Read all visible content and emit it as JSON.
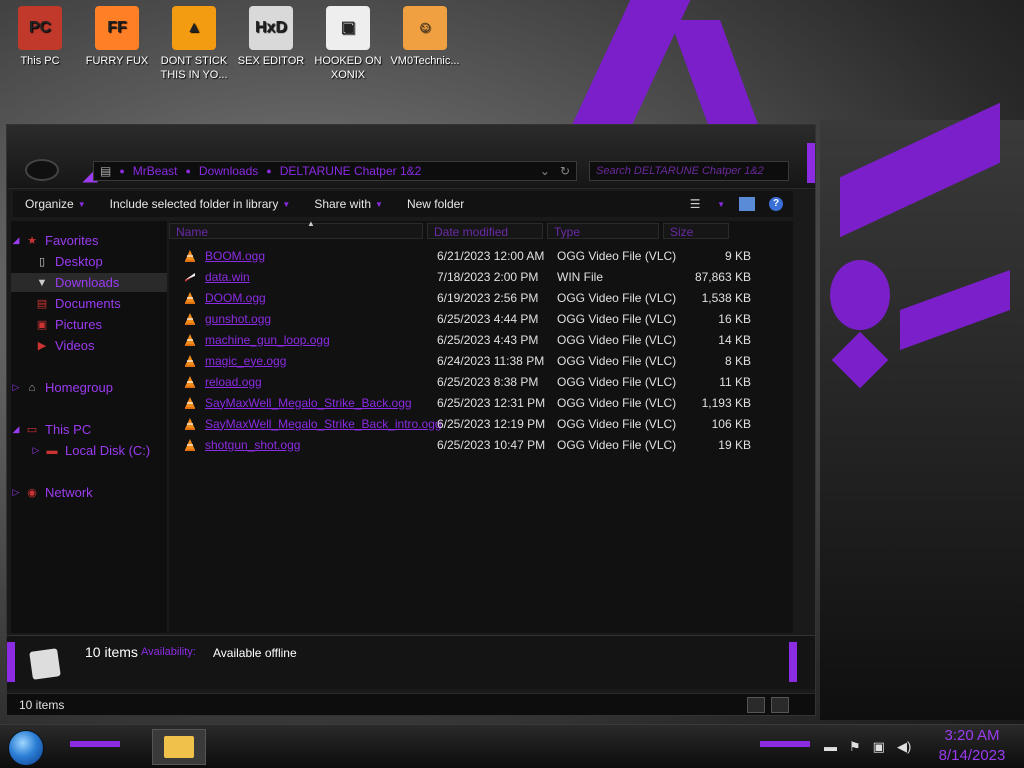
{
  "desktop": {
    "icons": [
      {
        "label": "This PC",
        "color": "#c0392b",
        "glyph": "PC"
      },
      {
        "label": "FURRY FUX",
        "color": "#ff7f27",
        "glyph": "FF"
      },
      {
        "label": "DONT STICK THIS IN YO...",
        "color": "#f39c12",
        "glyph": "▲"
      },
      {
        "label": "SEX EDITOR",
        "color": "#d9d9d9",
        "glyph": "HxD"
      },
      {
        "label": "HOOKED ON XONIX",
        "color": "#eeeeee",
        "glyph": "▣"
      },
      {
        "label": "VM0Technic...",
        "color": "#f0a040",
        "glyph": "☺"
      }
    ]
  },
  "window": {
    "breadcrumbs": [
      "MrBeast",
      "Downloads",
      "DELTARUNE Chatper 1&2"
    ],
    "search_placeholder": "Search DELTARUNE Chatper 1&2",
    "toolbar": {
      "organize": "Organize",
      "include_library": "Include selected folder in library",
      "share_with": "Share with",
      "new_folder": "New folder"
    },
    "nav": {
      "favorites": "Favorites",
      "desktop": "Desktop",
      "downloads": "Downloads",
      "documents": "Documents",
      "pictures": "Pictures",
      "videos": "Videos",
      "homegroup": "Homegroup",
      "this_pc": "This PC",
      "local_disk": "Local Disk (C:)",
      "network": "Network"
    },
    "columns": {
      "name": "Name",
      "date": "Date modified",
      "type": "Type",
      "size": "Size"
    },
    "files": [
      {
        "name": "BOOM.ogg",
        "date": "6/21/2023 12:00 AM",
        "type": "OGG Video File (VLC)",
        "size": "9 KB",
        "icon": "vlc-icon"
      },
      {
        "name": "data.win",
        "date": "7/18/2023 2:00 PM",
        "type": "WIN File",
        "size": "87,863 KB",
        "icon": "file-icon"
      },
      {
        "name": "DOOM.ogg",
        "date": "6/19/2023 2:56 PM",
        "type": "OGG Video File (VLC)",
        "size": "1,538 KB",
        "icon": "vlc-icon"
      },
      {
        "name": "gunshot.ogg",
        "date": "6/25/2023 4:44 PM",
        "type": "OGG Video File (VLC)",
        "size": "16 KB",
        "icon": "vlc-icon"
      },
      {
        "name": "machine_gun_loop.ogg",
        "date": "6/25/2023 4:43 PM",
        "type": "OGG Video File (VLC)",
        "size": "14 KB",
        "icon": "vlc-icon"
      },
      {
        "name": "magic_eye.ogg",
        "date": "6/24/2023 11:38 PM",
        "type": "OGG Video File (VLC)",
        "size": "8 KB",
        "icon": "vlc-icon"
      },
      {
        "name": "reload.ogg",
        "date": "6/25/2023 8:38 PM",
        "type": "OGG Video File (VLC)",
        "size": "11 KB",
        "icon": "vlc-icon"
      },
      {
        "name": "SayMaxWell_Megalo_Strike_Back.ogg",
        "date": "6/25/2023 12:31 PM",
        "type": "OGG Video File (VLC)",
        "size": "1,193 KB",
        "icon": "vlc-icon"
      },
      {
        "name": "SayMaxWell_Megalo_Strike_Back_intro.ogg",
        "date": "6/25/2023 12:19 PM",
        "type": "OGG Video File (VLC)",
        "size": "106 KB",
        "icon": "vlc-icon"
      },
      {
        "name": "shotgun_shot.ogg",
        "date": "6/25/2023 10:47 PM",
        "type": "OGG Video File (VLC)",
        "size": "19 KB",
        "icon": "vlc-icon"
      }
    ],
    "details": {
      "count": "10 items",
      "availability_label": "Availability:",
      "availability_value": "Available offline"
    },
    "status": {
      "items": "10 items"
    }
  },
  "taskbar": {
    "time": "3:20 AM",
    "date": "8/14/2023"
  },
  "colors": {
    "accent": "#8b2be2",
    "vlc": "#f28c1a"
  }
}
